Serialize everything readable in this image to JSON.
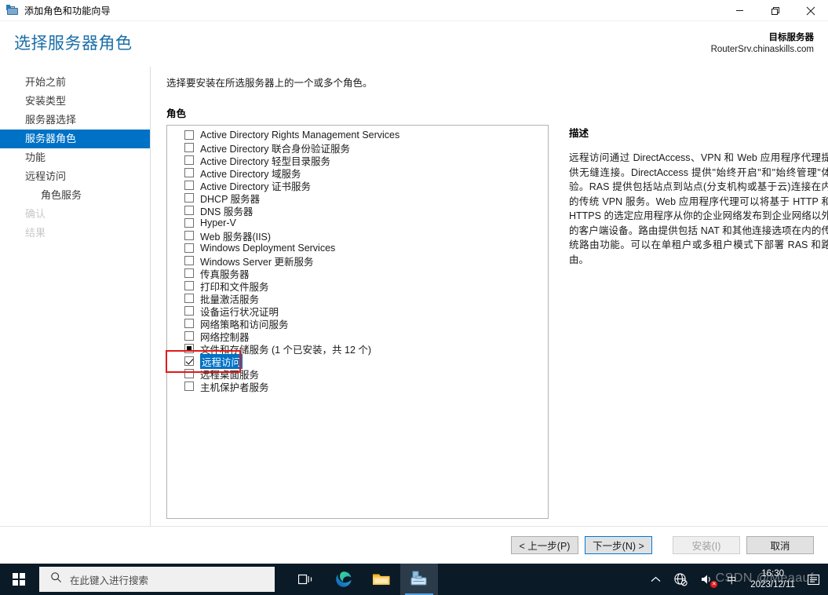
{
  "window": {
    "title": "添加角色和功能向导",
    "icon": "server-manager-icon",
    "minimize_label": "最小化",
    "restore_label": "向下还原",
    "close_label": "关闭"
  },
  "header": {
    "page_title": "选择服务器角色",
    "destination_label": "目标服务器",
    "destination_server": "RouterSrv.chinaskills.com",
    "accent_color": "#1a6ea8"
  },
  "sidebar": {
    "items": [
      {
        "label": "开始之前",
        "state": "normal",
        "indent": false
      },
      {
        "label": "安装类型",
        "state": "normal",
        "indent": false
      },
      {
        "label": "服务器选择",
        "state": "normal",
        "indent": false
      },
      {
        "label": "服务器角色",
        "state": "selected",
        "indent": false
      },
      {
        "label": "功能",
        "state": "normal",
        "indent": false
      },
      {
        "label": "远程访问",
        "state": "normal",
        "indent": false
      },
      {
        "label": "角色服务",
        "state": "normal",
        "indent": true
      },
      {
        "label": "确认",
        "state": "disabled",
        "indent": false
      },
      {
        "label": "结果",
        "state": "disabled",
        "indent": false
      }
    ],
    "selected_color": "#0072c6"
  },
  "main": {
    "instruction": "选择要安装在所选服务器上的一个或多个角色。",
    "roles_label": "角色",
    "roles": [
      {
        "label": "Active Directory Rights Management Services",
        "checked": "unchecked",
        "selected": false
      },
      {
        "label": "Active Directory 联合身份验证服务",
        "checked": "unchecked",
        "selected": false
      },
      {
        "label": "Active Directory 轻型目录服务",
        "checked": "unchecked",
        "selected": false
      },
      {
        "label": "Active Directory 域服务",
        "checked": "unchecked",
        "selected": false
      },
      {
        "label": "Active Directory 证书服务",
        "checked": "unchecked",
        "selected": false
      },
      {
        "label": "DHCP 服务器",
        "checked": "unchecked",
        "selected": false
      },
      {
        "label": "DNS 服务器",
        "checked": "unchecked",
        "selected": false
      },
      {
        "label": "Hyper-V",
        "checked": "unchecked",
        "selected": false
      },
      {
        "label": "Web 服务器(IIS)",
        "checked": "unchecked",
        "selected": false
      },
      {
        "label": "Windows Deployment Services",
        "checked": "unchecked",
        "selected": false
      },
      {
        "label": "Windows Server 更新服务",
        "checked": "unchecked",
        "selected": false
      },
      {
        "label": "传真服务器",
        "checked": "unchecked",
        "selected": false
      },
      {
        "label": "打印和文件服务",
        "checked": "unchecked",
        "selected": false
      },
      {
        "label": "批量激活服务",
        "checked": "unchecked",
        "selected": false
      },
      {
        "label": "设备运行状况证明",
        "checked": "unchecked",
        "selected": false
      },
      {
        "label": "网络策略和访问服务",
        "checked": "unchecked",
        "selected": false
      },
      {
        "label": "网络控制器",
        "checked": "unchecked",
        "selected": false
      },
      {
        "label": "文件和存储服务 (1 个已安装，共 12 个)",
        "checked": "partial",
        "selected": false
      },
      {
        "label": "远程访问",
        "checked": "checked",
        "selected": true
      },
      {
        "label": "远程桌面服务",
        "checked": "unchecked",
        "selected": false
      },
      {
        "label": "主机保护者服务",
        "checked": "unchecked",
        "selected": false
      }
    ]
  },
  "description": {
    "title": "描述",
    "text": "远程访问通过 DirectAccess、VPN 和 Web 应用程序代理提供无缝连接。DirectAccess 提供\"始终开启\"和\"始终管理\"体验。RAS 提供包括站点到站点(分支机构或基于云)连接在内的传统 VPN 服务。Web 应用程序代理可以将基于 HTTP 和 HTTPS 的选定应用程序从你的企业网络发布到企业网络以外的客户端设备。路由提供包括 NAT 和其他连接选项在内的传统路由功能。可以在单租户或多租户模式下部署 RAS 和路由。"
  },
  "annotation": {
    "color": "#e01b1b",
    "target": "远程访问"
  },
  "footer": {
    "previous_label": "< 上一步(P)",
    "next_label": "下一步(N) >",
    "install_label": "安装(I)",
    "cancel_label": "取消",
    "install_enabled": false
  },
  "taskbar": {
    "start_label": "开始",
    "search_placeholder": "在此键入进行搜索",
    "items": [
      {
        "name": "task-view",
        "label": "任务视图"
      },
      {
        "name": "edge",
        "label": "Microsoft Edge"
      },
      {
        "name": "file-explorer",
        "label": "文件资源管理器"
      },
      {
        "name": "server-manager",
        "label": "服务器管理器"
      }
    ],
    "tray": {
      "show_hidden_label": "显示隐藏的图标",
      "network_label": "网络",
      "volume_label": "音量",
      "ime_label": "中",
      "time": "16:30",
      "date": "2023/12/11",
      "notifications_label": "通知"
    }
  },
  "watermark": {
    "text": "CSDN @Meaauf"
  }
}
